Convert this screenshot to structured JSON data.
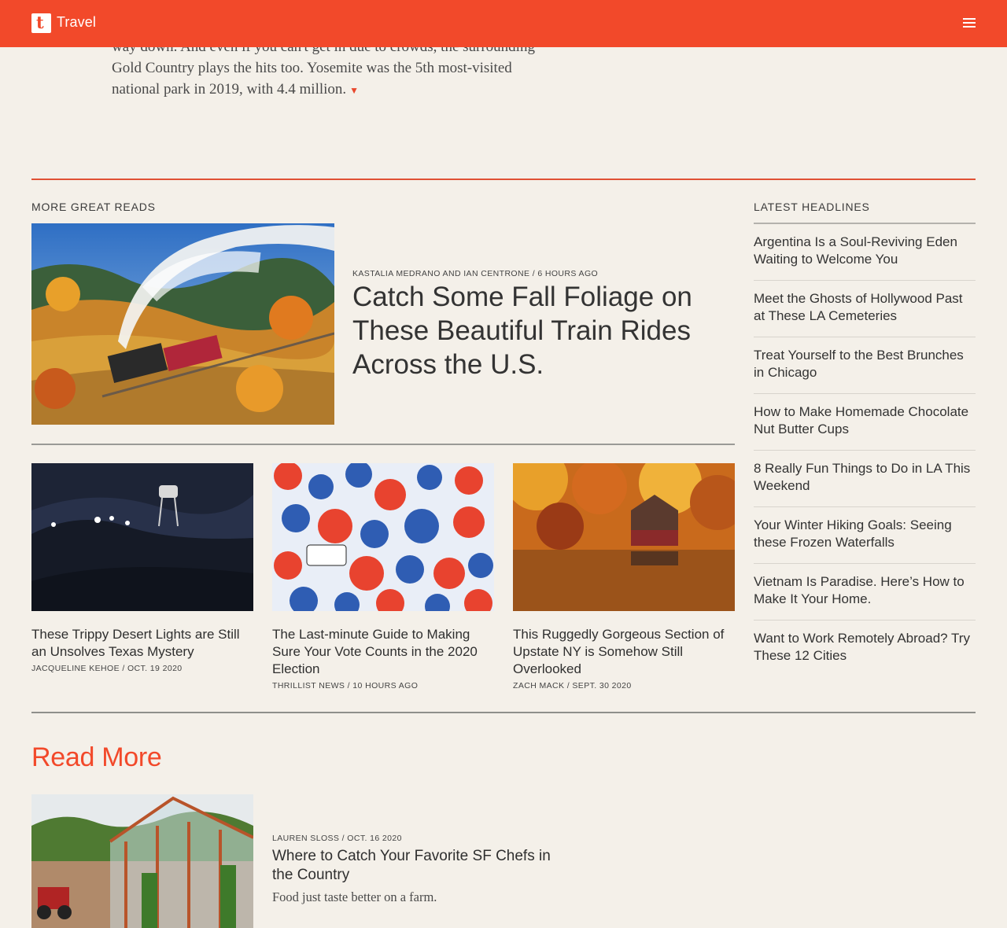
{
  "header": {
    "logo_letter": "t",
    "site_name": "Travel",
    "menu_icon": "hamburger-icon",
    "brand_color": "#f2492a"
  },
  "article_tail": {
    "line1": "way down. And even if you can't get in due to crowds, the surrounding",
    "line2": "Gold Country plays the hits too. Yosemite was the 5th most-visited",
    "line3": "national park in 2019, with 4.4 million.",
    "end_mark": "▼"
  },
  "more_great_reads": {
    "label": "MORE GREAT READS",
    "featured": {
      "meta": "KASTALIA MEDRANO AND IAN CENTRONE / 6 HOURS AGO",
      "title": "Catch Some Fall Foliage on These Beautiful Train Rides Across the U.S."
    },
    "cards": [
      {
        "title": "These Trippy Desert Lights are Still an Unsolves Texas Mystery",
        "meta": "JACQUELINE KEHOE / OCT. 19 2020"
      },
      {
        "title": "The Last-minute Guide to Making Sure Your Vote Counts in the 2020 Election",
        "meta": "THRILLIST NEWS / 10 HOURS AGO"
      },
      {
        "title": "This Ruggedly Gorgeous Section of Upstate NY is Somehow Still Overlooked",
        "meta": "ZACH MACK / SEPT. 30 2020"
      }
    ]
  },
  "latest_headlines": {
    "label": "LATEST HEADLINES",
    "items": [
      "Argentina Is a Soul-Reviving Eden Waiting to Welcome You",
      "Meet the Ghosts of Hollywood Past at These LA Cemeteries",
      "Treat Yourself to the Best Brunches in Chicago",
      "How to Make Homemade Chocolate Nut Butter Cups",
      "8 Really Fun Things to Do in LA This Weekend",
      "Your Winter Hiking Goals: Seeing these Frozen Waterfalls",
      "Vietnam Is Paradise. Here’s How to Make It Your Home.",
      "Want to Work Remotely Abroad? Try These 12 Cities"
    ]
  },
  "read_more": {
    "heading": "Read More",
    "item": {
      "meta": "LAUREN SLOSS / OCT. 16 2020",
      "title": "Where to Catch Your Favorite SF Chefs in the Country",
      "dek": "Food just taste better on a farm."
    }
  }
}
